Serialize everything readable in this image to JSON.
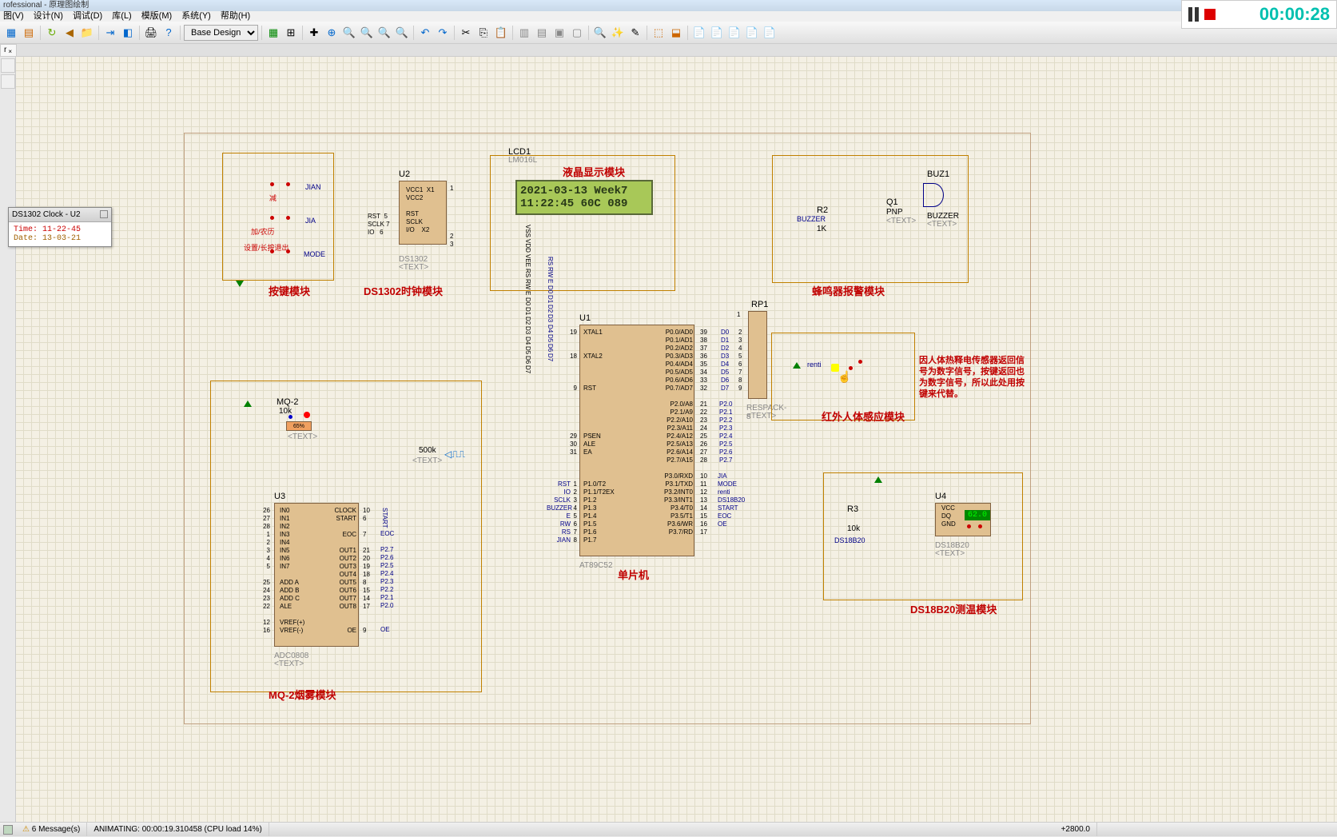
{
  "title": "rofessional - 原理图绘制",
  "menu": [
    "图(V)",
    "设计(N)",
    "调试(D)",
    "库(L)",
    "模版(M)",
    "系统(Y)",
    "帮助(H)"
  ],
  "toolbar": {
    "design_select": "Base Design"
  },
  "tab": {
    "label": "r"
  },
  "clock_window": {
    "title": "DS1302 Clock - U2",
    "time_label": "Time:",
    "time_value": "11-22-45",
    "date_label": "Date:",
    "date_value": "13-03-21"
  },
  "modules": {
    "keys": "按键模块",
    "ds1302": "DS1302时钟模块",
    "lcd": "液晶显示模块",
    "buzzer": "蜂鸣器报警模块",
    "mq2": "MQ-2烟雾模块",
    "mcu": "单片机",
    "ir": "红外人体感应模块",
    "ds18b20": "DS18B20测温模块"
  },
  "key_labels": {
    "jian": "JIAN",
    "jia": "JIA",
    "mode": "MODE",
    "jianzh": "减",
    "jianl": "加/农历",
    "shezhi": "设置/长按退出"
  },
  "lcd": {
    "ref": "LCD1",
    "val": "LM016L",
    "line1": "2021-03-13 Week7",
    "line2": "11:22:45 60C 089",
    "pins": [
      "VSS",
      "VDD",
      "VEE",
      "RS",
      "RW",
      "E",
      "D0",
      "D1",
      "D2",
      "D3",
      "D4",
      "D5",
      "D6",
      "D7"
    ]
  },
  "u1": {
    "ref": "U1",
    "val": "AT89C52"
  },
  "u2": {
    "ref": "U2",
    "val": "DS1302",
    "text": "<TEXT>"
  },
  "u3": {
    "ref": "U3",
    "val": "ADC0808",
    "text": "<TEXT>"
  },
  "u4": {
    "ref": "U4",
    "val": "DS18B20",
    "text": "<TEXT>",
    "disp": "62.0"
  },
  "rp1": {
    "ref": "RP1",
    "val": "RESPACK-8",
    "text": "<TEXT>"
  },
  "r2": {
    "ref": "R2",
    "val": "1K",
    "net": "BUZZER"
  },
  "r3": {
    "ref": "R3",
    "val": "10k",
    "net": "DS18B20"
  },
  "q1": {
    "ref": "Q1",
    "val": "PNP",
    "text": "<TEXT>"
  },
  "buz1": {
    "ref": "BUZ1",
    "val": "BUZZER",
    "text": "<TEXT>"
  },
  "mq2": {
    "ref": "MQ-2",
    "val": "10k",
    "pct": "65%",
    "text": "<TEXT>"
  },
  "sig": {
    "val": "500k",
    "text": "<TEXT>"
  },
  "renti": "renti",
  "ir_note": "因人体热释电传感器返回信号为数字信号，按键返回也为数字信号，所以此处用按键来代替。",
  "u1_pins_left": [
    {
      "n": "19",
      "l": "XTAL1"
    },
    {
      "n": "18",
      "l": "XTAL2"
    },
    {
      "n": "9",
      "l": "RST"
    },
    {
      "n": "29",
      "l": "PSEN"
    },
    {
      "n": "30",
      "l": "ALE"
    },
    {
      "n": "31",
      "l": "EA"
    },
    {
      "n": "1",
      "l": "P1.0/T2"
    },
    {
      "n": "2",
      "l": "P1.1/T2EX"
    },
    {
      "n": "3",
      "l": "P1.2"
    },
    {
      "n": "4",
      "l": "P1.3"
    },
    {
      "n": "5",
      "l": "P1.4"
    },
    {
      "n": "6",
      "l": "P1.5"
    },
    {
      "n": "7",
      "l": "P1.6"
    },
    {
      "n": "8",
      "l": "P1.7"
    }
  ],
  "u1_pins_right": [
    {
      "n": "39",
      "l": "P0.0/AD0"
    },
    {
      "n": "38",
      "l": "P0.1/AD1"
    },
    {
      "n": "37",
      "l": "P0.2/AD2"
    },
    {
      "n": "36",
      "l": "P0.3/AD3"
    },
    {
      "n": "35",
      "l": "P0.4/AD4"
    },
    {
      "n": "34",
      "l": "P0.5/AD5"
    },
    {
      "n": "33",
      "l": "P0.6/AD6"
    },
    {
      "n": "32",
      "l": "P0.7/AD7"
    },
    {
      "n": "21",
      "l": "P2.0/A8"
    },
    {
      "n": "22",
      "l": "P2.1/A9"
    },
    {
      "n": "23",
      "l": "P2.2/A10"
    },
    {
      "n": "24",
      "l": "P2.3/A11"
    },
    {
      "n": "25",
      "l": "P2.4/A12"
    },
    {
      "n": "26",
      "l": "P2.5/A13"
    },
    {
      "n": "27",
      "l": "P2.6/A14"
    },
    {
      "n": "28",
      "l": "P2.7/A15"
    },
    {
      "n": "10",
      "l": "P3.0/RXD"
    },
    {
      "n": "11",
      "l": "P3.1/TXD"
    },
    {
      "n": "12",
      "l": "P3.2/INT0"
    },
    {
      "n": "13",
      "l": "P3.3/INT1"
    },
    {
      "n": "14",
      "l": "P3.4/T0"
    },
    {
      "n": "15",
      "l": "P3.5/T1"
    },
    {
      "n": "16",
      "l": "P3.6/WR"
    },
    {
      "n": "17",
      "l": "P3.7/RD"
    }
  ],
  "u1_nets_left": [
    "RST",
    "IO",
    "SCLK",
    "BUZZER",
    "E",
    "RW",
    "RS",
    "JIAN"
  ],
  "u1_nets_right_top": [
    "D0",
    "D1",
    "D2",
    "D3",
    "D4",
    "D5",
    "D6",
    "D7"
  ],
  "u1_nets_right_mid": [
    "P2.0",
    "P2.1",
    "P2.2",
    "P2.3",
    "P2.4",
    "P2.5",
    "P2.6",
    "P2.7"
  ],
  "u1_nets_right_bot": [
    "JIA",
    "MODE",
    "renti",
    "DS18B20",
    "START",
    "EOC",
    "OE",
    ""
  ],
  "rp1_pins": [
    "2",
    "3",
    "4",
    "5",
    "6",
    "7",
    "8",
    "9"
  ],
  "u2_pins_l": [
    {
      "n": "5",
      "l": "RST"
    },
    {
      "n": "7",
      "l": "SCLK"
    },
    {
      "n": "6",
      "l": "IO"
    }
  ],
  "u2_pins_r": [
    {
      "n": "1",
      "l": "VCC1  X1"
    },
    {
      "n": "",
      "l": "VCC2"
    },
    {
      "n": "",
      "l": "RST"
    },
    {
      "n": "",
      "l": "SCLK"
    },
    {
      "n": "",
      "l": "I/O    X2"
    }
  ],
  "u3_pins_l": [
    {
      "n": "26",
      "l": "IN0"
    },
    {
      "n": "27",
      "l": "IN1"
    },
    {
      "n": "28",
      "l": "IN2"
    },
    {
      "n": "1",
      "l": "IN3"
    },
    {
      "n": "2",
      "l": "IN4"
    },
    {
      "n": "3",
      "l": "IN5"
    },
    {
      "n": "4",
      "l": "IN6"
    },
    {
      "n": "5",
      "l": "IN7"
    },
    {
      "n": "25",
      "l": "ADD A"
    },
    {
      "n": "24",
      "l": "ADD B"
    },
    {
      "n": "23",
      "l": "ADD C"
    },
    {
      "n": "22",
      "l": "ALE"
    },
    {
      "n": "12",
      "l": "VREF(+)"
    },
    {
      "n": "16",
      "l": "VREF(-)"
    }
  ],
  "u3_pins_r": [
    {
      "n": "10",
      "l": "CLOCK"
    },
    {
      "n": "6",
      "l": "START"
    },
    {
      "n": "7",
      "l": "EOC"
    },
    {
      "n": "21",
      "l": "OUT1"
    },
    {
      "n": "20",
      "l": "OUT2"
    },
    {
      "n": "19",
      "l": "OUT3"
    },
    {
      "n": "18",
      "l": "OUT4"
    },
    {
      "n": "8",
      "l": "OUT5"
    },
    {
      "n": "15",
      "l": "OUT6"
    },
    {
      "n": "14",
      "l": "OUT7"
    },
    {
      "n": "17",
      "l": "OUT8"
    },
    {
      "n": "9",
      "l": "OE"
    }
  ],
  "u3_nets_r": [
    "START",
    "EOC",
    "P2.7",
    "P2.6",
    "P2.5",
    "P2.4",
    "P2.3",
    "P2.2",
    "P2.1",
    "P2.0",
    "OE"
  ],
  "u4_pins": [
    "VCC",
    "DQ",
    "GND"
  ],
  "status": {
    "messages": "6 Message(s)",
    "animating": "ANIMATING: 00:00:19.310458 (CPU load 14%)",
    "coord": "+2800.0"
  },
  "recorder": {
    "time": "00:00:28"
  }
}
